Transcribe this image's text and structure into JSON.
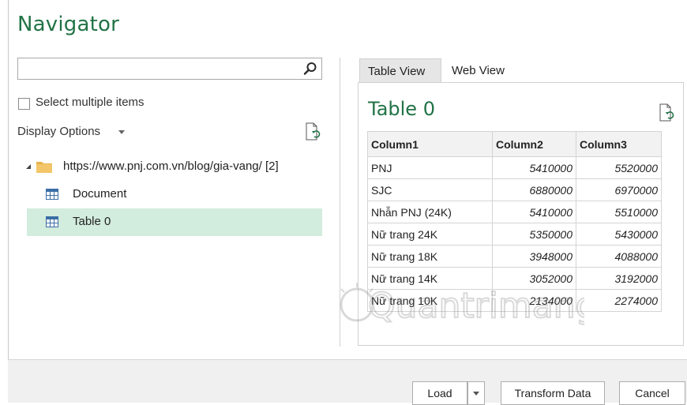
{
  "title": "Navigator",
  "search": {
    "placeholder": "",
    "value": ""
  },
  "select_multiple_label": "Select multiple items",
  "display_options_label": "Display Options",
  "tree": {
    "root": "https://www.pnj.com.vn/blog/gia-vang/ [2]",
    "items": [
      "Document",
      "Table 0"
    ],
    "selected": "Table 0"
  },
  "tabs": [
    "Table View",
    "Web View"
  ],
  "preview": {
    "title": "Table 0",
    "columns": [
      "Column1",
      "Column2",
      "Column3"
    ],
    "rows": [
      [
        "PNJ",
        "5410000",
        "5520000"
      ],
      [
        "SJC",
        "6880000",
        "6970000"
      ],
      [
        "Nhẫn PNJ (24K)",
        "5410000",
        "5510000"
      ],
      [
        "Nữ trang 24K",
        "5350000",
        "5430000"
      ],
      [
        "Nữ trang 18K",
        "3948000",
        "4088000"
      ],
      [
        "Nữ trang 14K",
        "3052000",
        "3192000"
      ],
      [
        "Nữ trang 10K",
        "2134000",
        "2274000"
      ]
    ]
  },
  "watermark": "Quantrimang",
  "buttons": {
    "load": "Load",
    "transform": "Transform Data",
    "cancel": "Cancel"
  },
  "icons": {
    "search": "search-icon",
    "refresh": "refresh-icon",
    "folder": "folder-icon",
    "table": "table-icon"
  },
  "colors": {
    "accent": "#217346",
    "selection": "#d2ecdd"
  }
}
